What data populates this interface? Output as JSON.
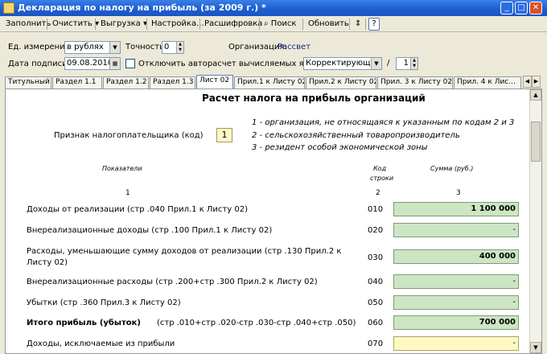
{
  "window": {
    "title": "Декларация по налогу на прибыль (за 2009 г.) *"
  },
  "toolbar": {
    "fill": "Заполнить",
    "clear": "Очистить",
    "export": "Выгрузка",
    "settings": "Настройка...",
    "decode": "Расшифровка",
    "search": "Поиск",
    "refresh": "Обновить",
    "help": "?"
  },
  "params": {
    "unit_label": "Ед. измерения:",
    "unit_value": "в рублях",
    "precision_label": "Точность:",
    "precision_value": "0",
    "org_label": "Организация:",
    "org_value": "Рассвет",
    "sign_date_label": "Дата подписи:",
    "sign_date_value": "09.08.2010",
    "autocalc_label": "Отключить авторасчет вычисляемых ячеек",
    "doc_type_value": "Корректирующий",
    "slash": "/",
    "correction_number": "1"
  },
  "tabs": [
    "Титульный",
    "Раздел 1.1",
    "Раздел 1.2",
    "Раздел 1.3",
    "Лист 02",
    "Прил.1 к Листу 02",
    "Прил.2 к Листу 02",
    "Прил. 3 к Листу 02",
    "Прил. 4 к Лис..."
  ],
  "sheet": {
    "title": "Расчет налога на прибыль организаций",
    "taxpayer_label": "Признак налогоплательщика (код)",
    "taxpayer_code": "1",
    "legend": [
      "1 - организация, не относящаяся к указанным по кодам 2 и 3",
      "2 - сельскохозяйственный товаропроизводитель",
      "3 - резидент особой экономической зоны"
    ],
    "col_indicators": "Показатели",
    "col_code_1": "Код",
    "col_code_2": "строки",
    "col_sum": "Сумма (руб.)",
    "num_1": "1",
    "num_2": "2",
    "num_3": "3",
    "rows": [
      {
        "label": "Доходы от реализации (стр .040 Прил.1 к Листу 02)",
        "code": "010",
        "value": "1 100 000"
      },
      {
        "label": "Внереализационные доходы (стр .100 Прил.1 к Листу 02)",
        "code": "020",
        "value": "-"
      },
      {
        "label": "Расходы, уменьшающие сумму доходов от реализации (стр .130 Прил.2 к",
        "label2": "Листу 02)",
        "code": "030",
        "value": "400 000"
      },
      {
        "label": "Внереализационные расходы (стр .200+стр .300 Прил.2 к Листу 02)",
        "code": "040",
        "value": "-"
      },
      {
        "label": "Убытки (стр .360 Прил.3 к Листу 02)",
        "code": "050",
        "value": "-"
      },
      {
        "label": "Итого прибыль (убыток)",
        "label_formula": "(стр .010+стр .020-стр .030-стр .040+стр .050)",
        "code": "060",
        "value": "700 000"
      },
      {
        "label": "Доходы, исключаемые из прибыли",
        "code": "070",
        "value": "-"
      }
    ]
  }
}
